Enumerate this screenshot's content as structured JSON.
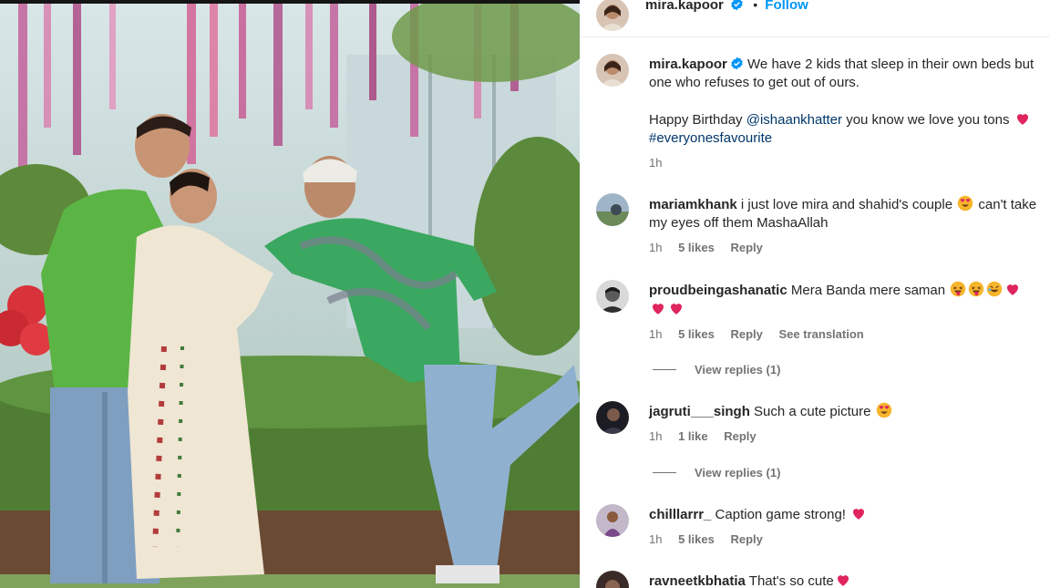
{
  "post": {
    "username": "mira.kapoor",
    "follow_label": "Follow",
    "dot": "•",
    "caption_line1": "We have 2 kids that sleep in their own beds but one who refuses to get out of ours.",
    "caption_line2_pre": "Happy Birthday ",
    "caption_mention": "@ishaankhatter",
    "caption_line2_post": " you know we love you tons ",
    "caption_hashtag": "#everyonesfavourite",
    "caption_time": "1h"
  },
  "comments": [
    {
      "username": "mariamkhank",
      "text": "i just love mira and shahid's couple ",
      "text_after": " can't take my eyes off them MashaAllah",
      "time": "1h",
      "likes": "5 likes",
      "reply": "Reply",
      "avatar_color": "#6f8fa8"
    },
    {
      "username": "proudbeingashanatic",
      "text": "Mera Banda mere saman ",
      "time": "1h",
      "likes": "5 likes",
      "reply": "Reply",
      "translation": "See translation",
      "view_replies": "View replies (1)",
      "avatar_color": "#444444"
    },
    {
      "username": "jagruti___singh",
      "text": "Such a cute picture ",
      "time": "1h",
      "likes": "1 like",
      "reply": "Reply",
      "view_replies": "View replies (1)",
      "avatar_color": "#2a2a35"
    },
    {
      "username": "chilllarrr_",
      "text": "Caption game strong! ",
      "time": "1h",
      "likes": "5 likes",
      "reply": "Reply",
      "avatar_color": "#8c6a9e"
    },
    {
      "username": "ravneetkbhatia",
      "text": "That's so cute",
      "avatar_color": "#3a2a28"
    }
  ],
  "icons": {
    "verified": "verified-badge-icon",
    "heart": "red-heart-emoji",
    "heart_eyes": "heart-eyes-emoji",
    "tongue": "winking-tongue-emoji",
    "laugh": "rofl-emoji"
  },
  "colors": {
    "accent": "#0095f6",
    "link": "#00376b",
    "muted": "#737373",
    "heart": "#e0245e"
  }
}
